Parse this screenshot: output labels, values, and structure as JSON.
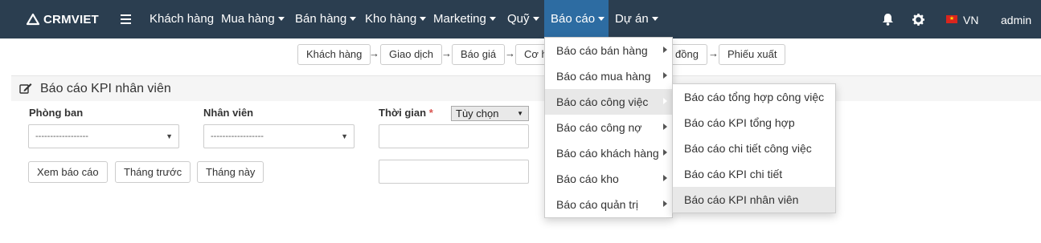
{
  "brand": {
    "name": "CRMVIET"
  },
  "nav": {
    "items": [
      {
        "label": "Khách hàng"
      },
      {
        "label": "Mua hàng"
      },
      {
        "label": "Bán hàng"
      },
      {
        "label": "Kho hàng"
      },
      {
        "label": "Marketing"
      },
      {
        "label": "Quỹ"
      },
      {
        "label": "Báo cáo"
      },
      {
        "label": "Dự án"
      }
    ],
    "language": "VN",
    "user": "admin"
  },
  "workflow": {
    "steps": [
      "Khách hàng",
      "Giao dịch",
      "Báo giá",
      "Cơ h",
      "đồng",
      "Phiếu xuất"
    ],
    "arrow": "→"
  },
  "panel": {
    "title": "Báo cáo KPI nhân viên"
  },
  "filters": {
    "department_label": "Phòng ban",
    "department_value": "------------------",
    "employee_label": "Nhân viên",
    "employee_value": "------------------",
    "time_label": "Thời gian",
    "required_mark": "*",
    "time_option": "Tùy chọn"
  },
  "buttons": {
    "view_report": "Xem báo cáo",
    "prev_month": "Tháng trước",
    "this_month": "Tháng này"
  },
  "report_menu": {
    "items": [
      "Báo cáo bán hàng",
      "Báo cáo mua hàng",
      "Báo cáo công việc",
      "Báo cáo công nợ",
      "Báo cáo khách hàng",
      "Báo cáo kho",
      "Báo cáo quản trị"
    ]
  },
  "work_submenu": {
    "items": [
      "Báo cáo tổng hợp công việc",
      "Báo cáo KPI tổng hợp",
      "Báo cáo chi tiết công việc",
      "Báo cáo KPI chi tiết",
      "Báo cáo KPI nhân viên"
    ]
  },
  "colors": {
    "navbar": "#2b3e50",
    "active_nav": "#2d6ca2",
    "required": "#d9534f"
  },
  "icons": [
    "logo-icon",
    "menu-icon",
    "bell-icon",
    "gear-icon",
    "flag-icon",
    "edit-icon",
    "chevron-down-icon",
    "chevron-right-icon"
  ]
}
